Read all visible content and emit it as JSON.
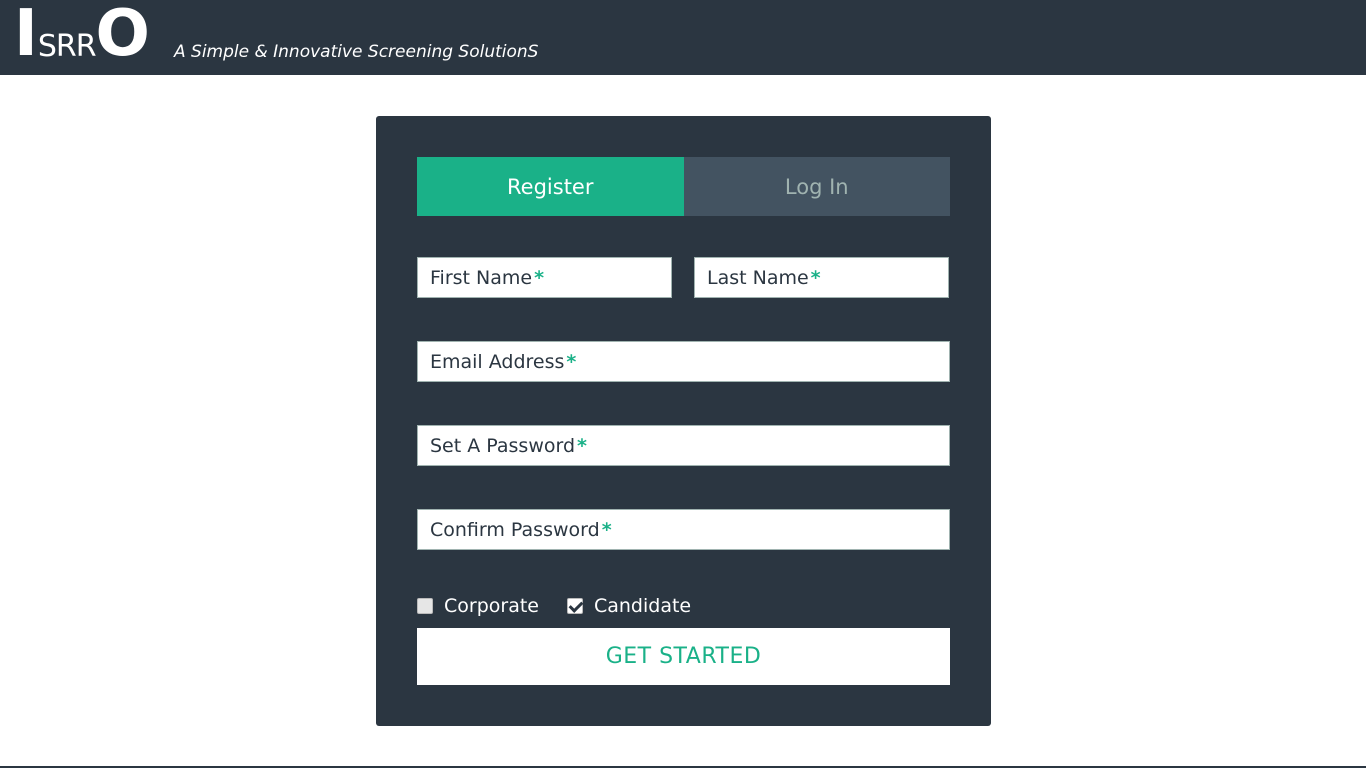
{
  "header": {
    "logo": {
      "first": "I",
      "middle": "SRR",
      "last": "O"
    },
    "tagline": "A Simple & Innovative Screening SolutionS"
  },
  "form": {
    "tabs": [
      {
        "label": "Register",
        "active": true
      },
      {
        "label": "Log In",
        "active": false
      }
    ],
    "fields": {
      "first_name": {
        "label": "First Name",
        "required_mark": "*",
        "value": ""
      },
      "last_name": {
        "label": "Last Name",
        "required_mark": "*",
        "value": ""
      },
      "email": {
        "label": "Email Address",
        "required_mark": "*",
        "value": ""
      },
      "password": {
        "label": "Set A Password",
        "required_mark": "*",
        "value": ""
      },
      "confirm_password": {
        "label": "Confirm Password",
        "required_mark": "*",
        "value": ""
      }
    },
    "user_types": [
      {
        "label": "Corporate",
        "checked": false
      },
      {
        "label": "Candidate",
        "checked": true
      }
    ],
    "submit_label": "GET STARTED"
  },
  "colors": {
    "header_bg": "#2b3641",
    "panel_bg": "#2b3641",
    "accent": "#1ab188",
    "tab_inactive_bg": "#435361",
    "tab_inactive_text": "#a0b3b0"
  }
}
